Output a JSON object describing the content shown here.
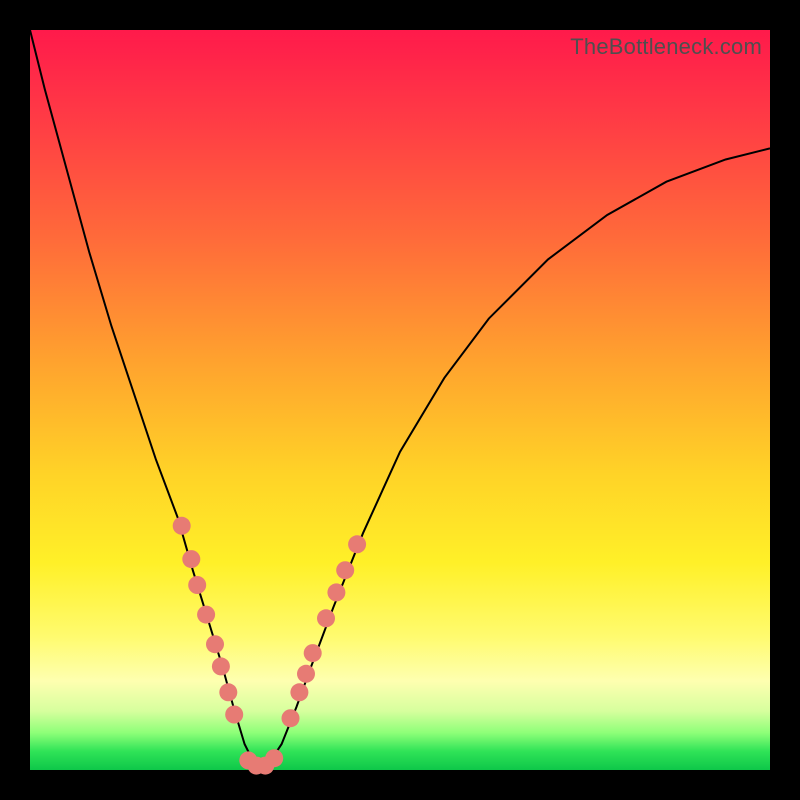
{
  "watermark": "TheBottleneck.com",
  "colors": {
    "dot": "#e77b74",
    "line": "#000000",
    "gradient_top": "#ff1a4b",
    "gradient_bottom": "#0ec749",
    "frame": "#000000"
  },
  "chart_data": {
    "type": "line",
    "title": "",
    "xlabel": "",
    "ylabel": "",
    "xlim": [
      0,
      100
    ],
    "ylim": [
      0,
      100
    ],
    "axes_visible": false,
    "grid": false,
    "note": "V-shaped bottleneck curve; y is approximate mismatch percentage (0 = optimal). Values read from plot geometry.",
    "series": [
      {
        "name": "bottleneck-curve",
        "x": [
          0,
          2,
          5,
          8,
          11,
          14,
          17,
          20,
          22,
          24,
          26,
          27.5,
          29,
          30.5,
          32,
          34,
          36,
          38,
          41,
          45,
          50,
          56,
          62,
          70,
          78,
          86,
          94,
          100
        ],
        "y": [
          100,
          92,
          81,
          70,
          60,
          51,
          42,
          34,
          27,
          20.5,
          14,
          8.5,
          3.5,
          0.5,
          0.5,
          3.5,
          8.5,
          14,
          22,
          32,
          43,
          53,
          61,
          69,
          75,
          79.5,
          82.5,
          84
        ]
      }
    ],
    "markers": [
      {
        "name": "left-cluster",
        "points": [
          {
            "x": 20.5,
            "y": 33
          },
          {
            "x": 21.8,
            "y": 28.5
          },
          {
            "x": 22.6,
            "y": 25
          },
          {
            "x": 23.8,
            "y": 21
          },
          {
            "x": 25.0,
            "y": 17
          },
          {
            "x": 25.8,
            "y": 14
          },
          {
            "x": 26.8,
            "y": 10.5
          },
          {
            "x": 27.6,
            "y": 7.5
          }
        ]
      },
      {
        "name": "bottom-cluster",
        "points": [
          {
            "x": 29.5,
            "y": 1.3
          },
          {
            "x": 30.6,
            "y": 0.6
          },
          {
            "x": 31.8,
            "y": 0.6
          },
          {
            "x": 33.0,
            "y": 1.6
          }
        ]
      },
      {
        "name": "right-cluster",
        "points": [
          {
            "x": 35.2,
            "y": 7
          },
          {
            "x": 36.4,
            "y": 10.5
          },
          {
            "x": 37.3,
            "y": 13
          },
          {
            "x": 38.2,
            "y": 15.8
          },
          {
            "x": 40.0,
            "y": 20.5
          },
          {
            "x": 41.4,
            "y": 24
          },
          {
            "x": 42.6,
            "y": 27
          },
          {
            "x": 44.2,
            "y": 30.5
          }
        ]
      }
    ]
  }
}
